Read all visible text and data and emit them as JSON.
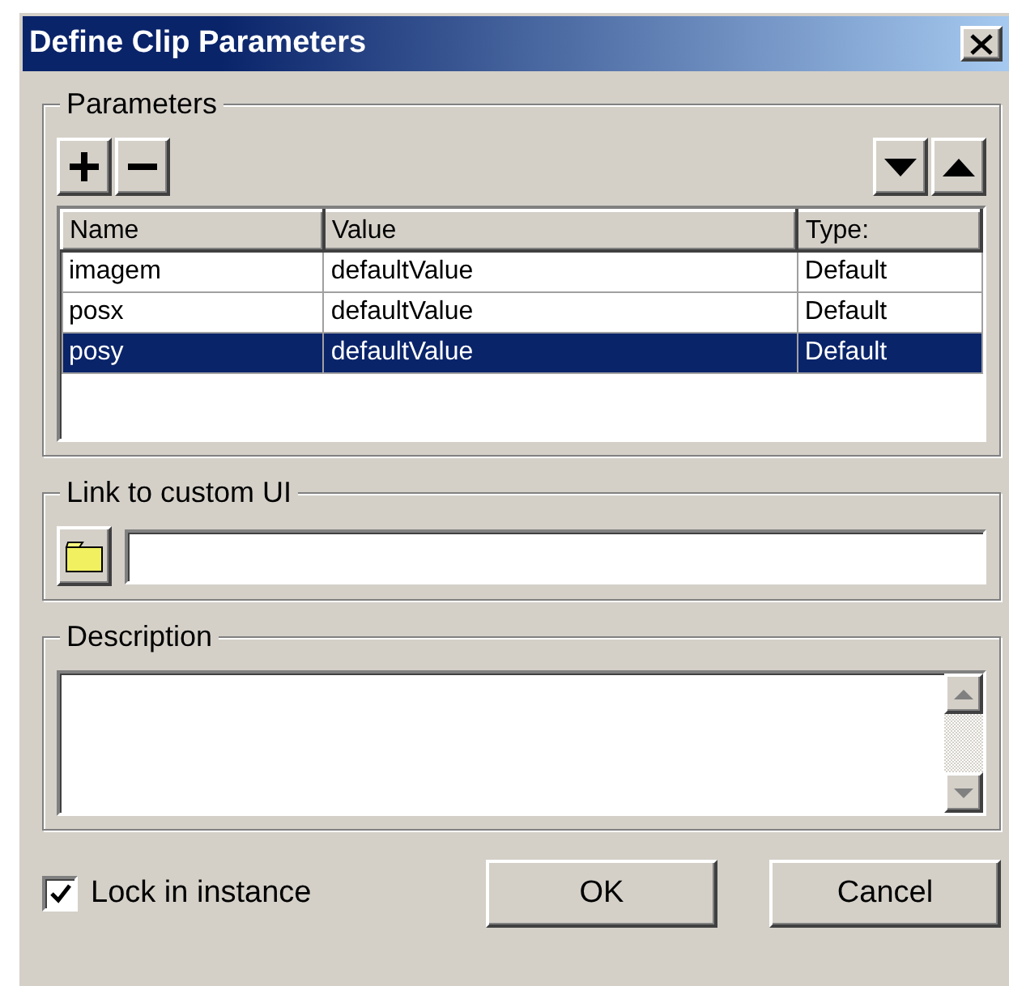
{
  "window": {
    "title": "Define Clip Parameters"
  },
  "parameters": {
    "label": "Parameters",
    "table": {
      "columns": [
        "Name",
        "Value",
        "Type:"
      ],
      "rows": [
        {
          "cells": [
            "imagem",
            "defaultValue",
            "Default"
          ],
          "selected": false
        },
        {
          "cells": [
            "posx",
            "defaultValue",
            "Default"
          ],
          "selected": false
        },
        {
          "cells": [
            "posy",
            "defaultValue",
            "Default"
          ],
          "selected": true
        }
      ]
    }
  },
  "link": {
    "label": "Link to custom UI"
  },
  "description": {
    "label": "Description"
  },
  "lock": {
    "label": "Lock in instance",
    "checked": true
  },
  "buttons": [
    {
      "label": "OK"
    },
    {
      "label": "Cancel"
    }
  ]
}
